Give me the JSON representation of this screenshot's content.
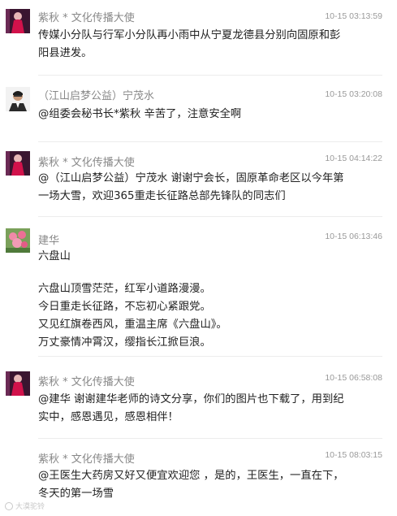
{
  "comments": [
    {
      "author": "紫秋 * 文化传播大使",
      "time": "10-15 03:13:59",
      "lines": [
        "传媒小分队与行军小分队再小雨中从宁夏龙德县分别向固原和彭",
        "阳县进发。"
      ]
    },
    {
      "author": "（江山启梦公益）宁茂水",
      "time": "10-15 03:20:08",
      "lines": [
        "@组委会秘书长*紫秋 辛苦了，注意安全啊"
      ]
    },
    {
      "author": "紫秋 * 文化传播大使",
      "time": "10-15 04:14:22",
      "lines": [
        "@（江山启梦公益）宁茂水 谢谢宁会长，固原革命老区以今年第",
        "一场大雪，欢迎365重走长征路总部先锋队的同志们"
      ]
    },
    {
      "author": "建华",
      "time": "10-15 06:13:46",
      "lines": [
        "六盘山",
        "",
        "六盘山顶雪茫茫，红军小道路漫漫。",
        "今日重走长征路，不忘初心紧跟党。",
        "又见红旗卷西风，重温主席《六盘山》。",
        "万丈豪情冲霄汉，缨指长江掀巨浪。"
      ]
    },
    {
      "author": "紫秋 * 文化传播大使",
      "time": "10-15 06:58:08",
      "lines": [
        "@建华 谢谢建华老师的诗文分享，你们的图片也下载了，用到纪",
        "实中，感恩遇见，感恩相伴！"
      ]
    },
    {
      "author": "紫秋 * 文化传播大使",
      "time": "10-15 08:03:15",
      "lines": [
        "@王医生大药房又好又便宜欢迎您 ，是的，王医生，一直在下，",
        "冬天的第一场雪"
      ]
    }
  ],
  "watermark": "大漠驼铃",
  "avatar_icons": [
    "profile-photo-woman-red",
    "profile-photo-man-suit",
    "profile-photo-woman-red",
    "profile-photo-flowers",
    "profile-photo-woman-red"
  ]
}
